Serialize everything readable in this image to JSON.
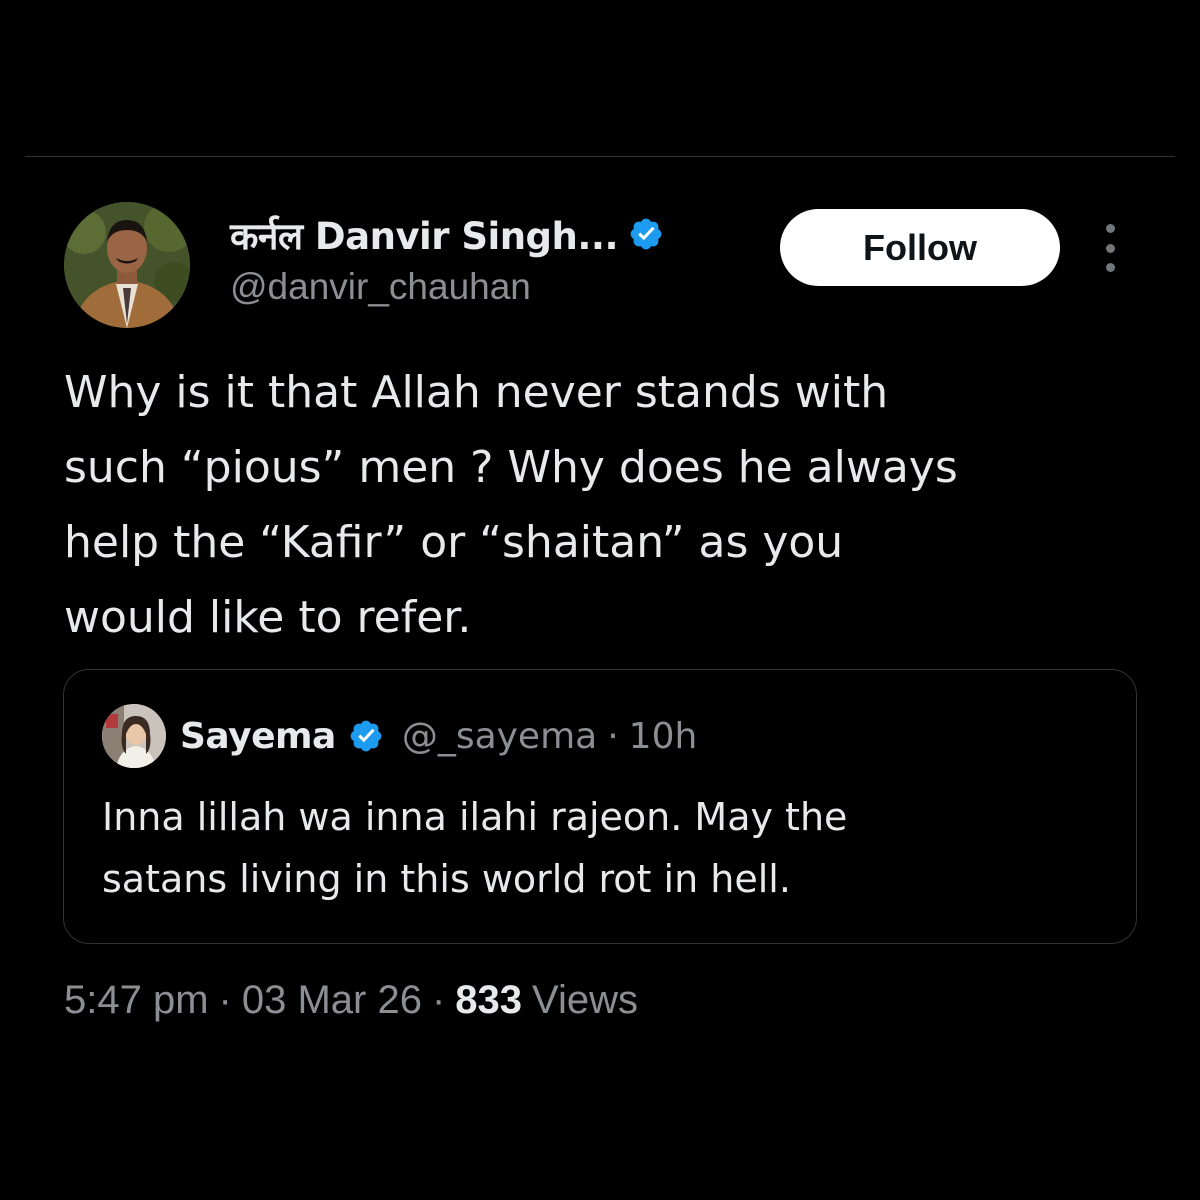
{
  "author": {
    "display_name": "कर्नल Danvir Singh...",
    "handle": "@danvir_chauhan",
    "verified": true,
    "avatar_icon": "person-avatar"
  },
  "actions": {
    "follow_label": "Follow",
    "more_icon": "more-vertical-icon"
  },
  "tweet": {
    "lines": [
      "Why is it that Allah never stands with",
      "such “pious” men ? Why does he always",
      "help the “Kafir” or “shaitan” as you",
      "would like to refer."
    ]
  },
  "quoted_tweet": {
    "display_name": "Sayema",
    "handle": "@_sayema",
    "separator": "·",
    "time": "10h",
    "verified": true,
    "lines": [
      "Inna lillah wa inna ilahi rajeon. May the",
      "satans living in this world rot in hell."
    ]
  },
  "meta": {
    "time": "5:47 pm",
    "date": "03 Mar 26",
    "separator": "·",
    "views_count": "833",
    "views_label": "Views"
  },
  "colors": {
    "background": "#000000",
    "text_primary": "#e7e9ea",
    "text_secondary": "#8b8f94",
    "verified_blue": "#1d9bf0",
    "divider": "#2f3336"
  }
}
